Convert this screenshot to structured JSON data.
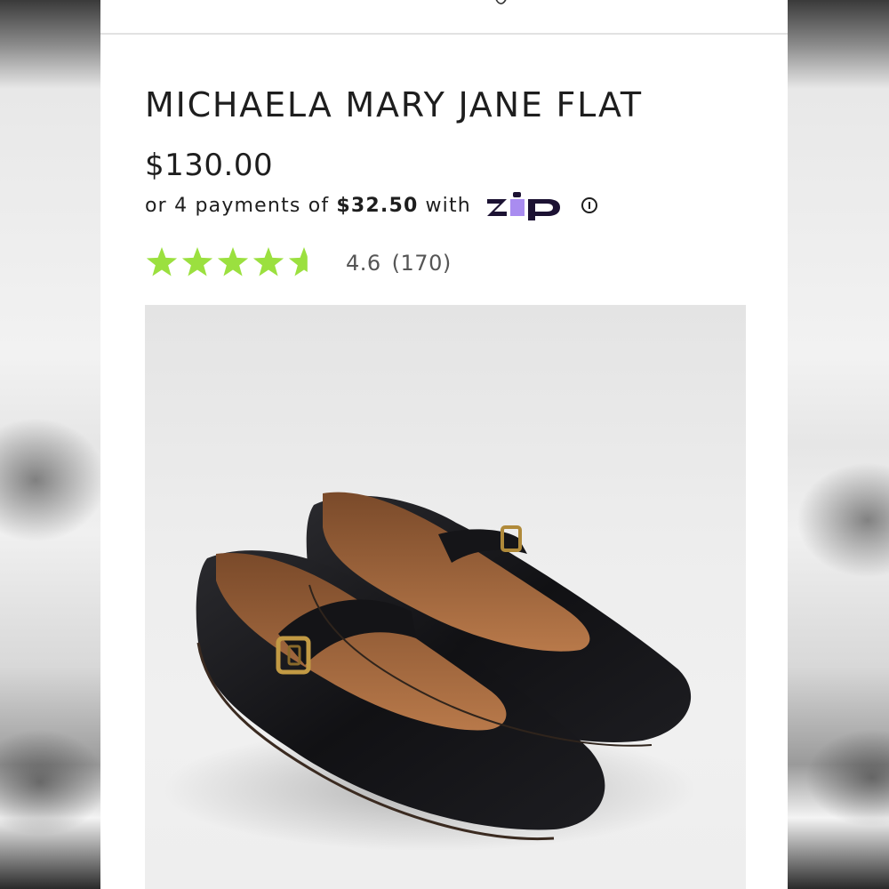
{
  "product": {
    "title": "MICHAELA MARY JANE FLAT",
    "price": "$130.00",
    "installment": {
      "prefix": "or 4 payments of",
      "amount": "$32.50",
      "suffix": "with",
      "provider": "zip",
      "provider_logo_text": "zip",
      "info_icon": "info-circle-icon"
    },
    "rating": {
      "value": 4.6,
      "max": 5,
      "display": "4.6",
      "count_display": "(170)",
      "star_color": "#9be03f"
    },
    "image": {
      "alt": "black leather mary jane flats with gold buckle strap"
    }
  },
  "colors": {
    "zip_purple": "#a98cf0",
    "zip_dark": "#1c1233",
    "text": "#1e1e1e",
    "muted_text": "#555555"
  }
}
